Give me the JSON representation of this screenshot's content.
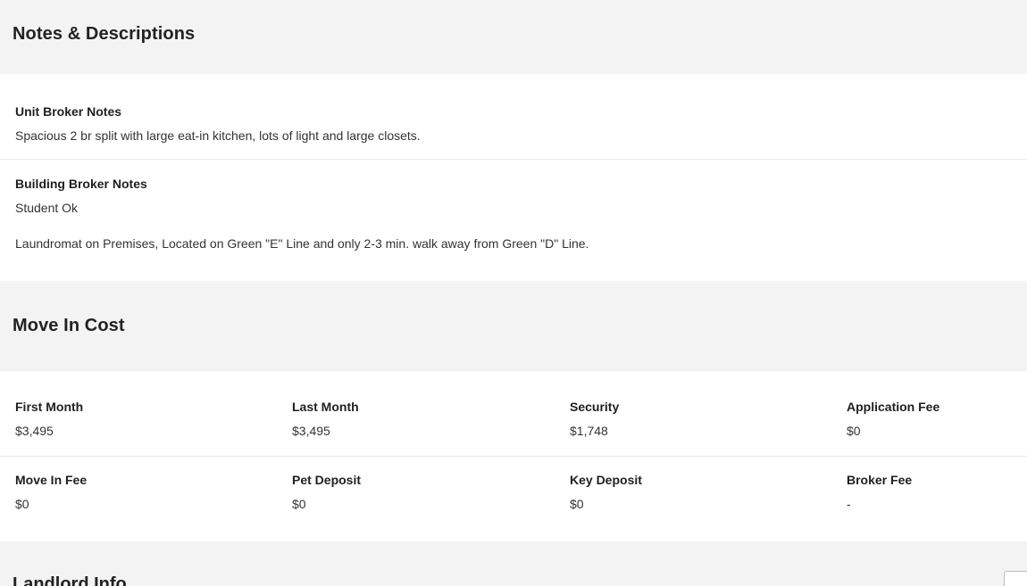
{
  "notes_section": {
    "title": "Notes & Descriptions",
    "unit_broker_notes": {
      "label": "Unit Broker Notes",
      "text": "Spacious 2 br split with large eat-in kitchen, lots of light and large closets."
    },
    "building_broker_notes": {
      "label": "Building Broker Notes",
      "text": "Student Ok",
      "text_2": "Laundromat on Premises, Located on Green \"E\" Line and only 2-3 min. walk away from Green \"D\" Line."
    }
  },
  "move_in_cost": {
    "title": "Move In Cost",
    "items": [
      {
        "label": "First Month",
        "value": "$3,495"
      },
      {
        "label": "Last Month",
        "value": "$3,495"
      },
      {
        "label": "Security",
        "value": "$1,748"
      },
      {
        "label": "Application Fee",
        "value": "$0"
      },
      {
        "label": "Move In Fee",
        "value": "$0"
      },
      {
        "label": "Pet Deposit",
        "value": "$0"
      },
      {
        "label": "Key Deposit",
        "value": "$0"
      },
      {
        "label": "Broker Fee",
        "value": "-"
      }
    ]
  },
  "landlord_section": {
    "title": "Landlord Info"
  },
  "colors": {
    "section_bg": "#f3f3f3",
    "panel_bg": "#ffffff",
    "divider": "#e6e6e6",
    "text": "#222222"
  }
}
